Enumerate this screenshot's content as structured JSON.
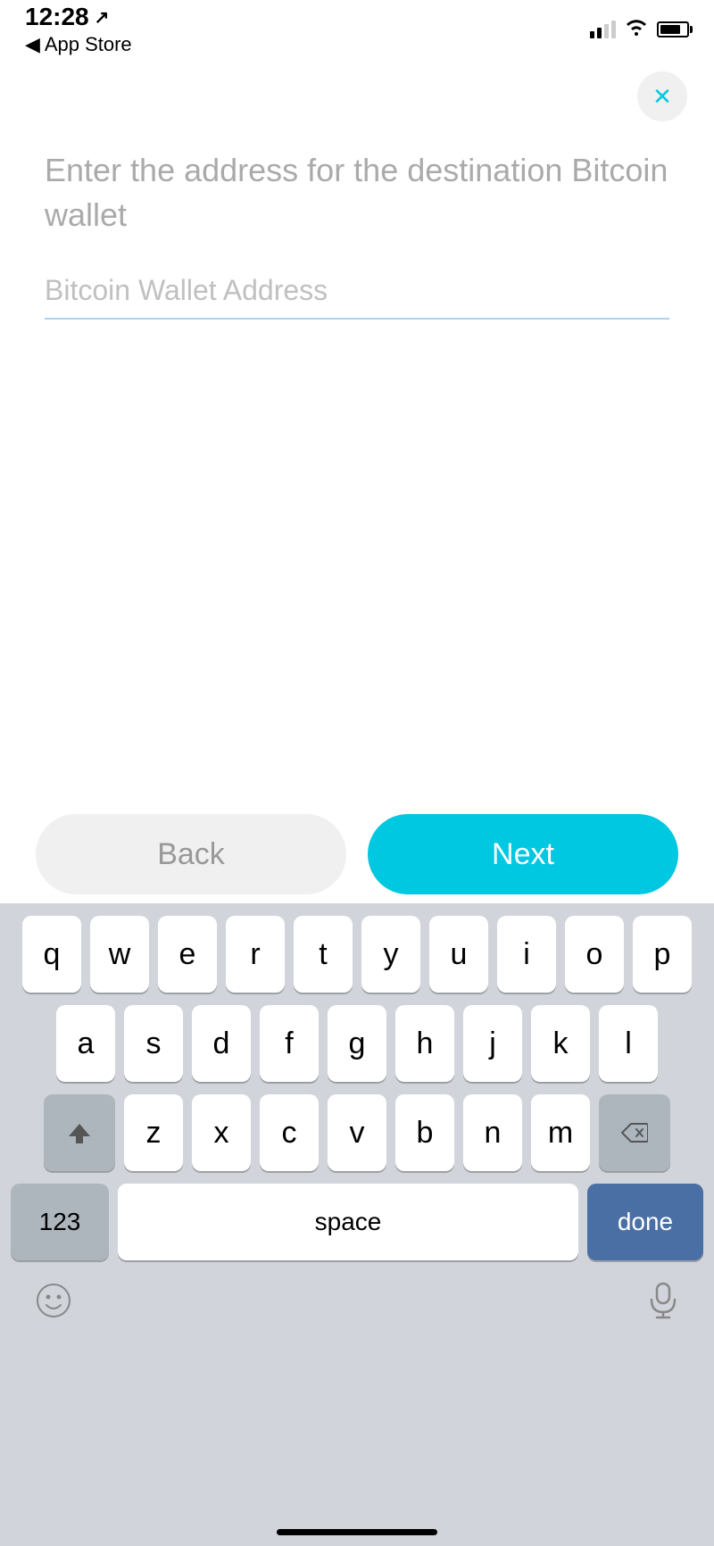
{
  "status": {
    "time": "12:28",
    "back_label": "◀ App Store"
  },
  "header": {
    "close_label": "✕"
  },
  "form": {
    "instruction": "Enter the address for the destination Bitcoin wallet",
    "input_placeholder": "Bitcoin Wallet Address",
    "input_value": ""
  },
  "buttons": {
    "back_label": "Back",
    "next_label": "Next"
  },
  "keyboard": {
    "row1": [
      "q",
      "w",
      "e",
      "r",
      "t",
      "y",
      "u",
      "i",
      "o",
      "p"
    ],
    "row2": [
      "a",
      "s",
      "d",
      "f",
      "g",
      "h",
      "j",
      "k",
      "l"
    ],
    "row3": [
      "z",
      "x",
      "c",
      "v",
      "b",
      "n",
      "m"
    ],
    "numbers_label": "123",
    "space_label": "space",
    "done_label": "done"
  }
}
